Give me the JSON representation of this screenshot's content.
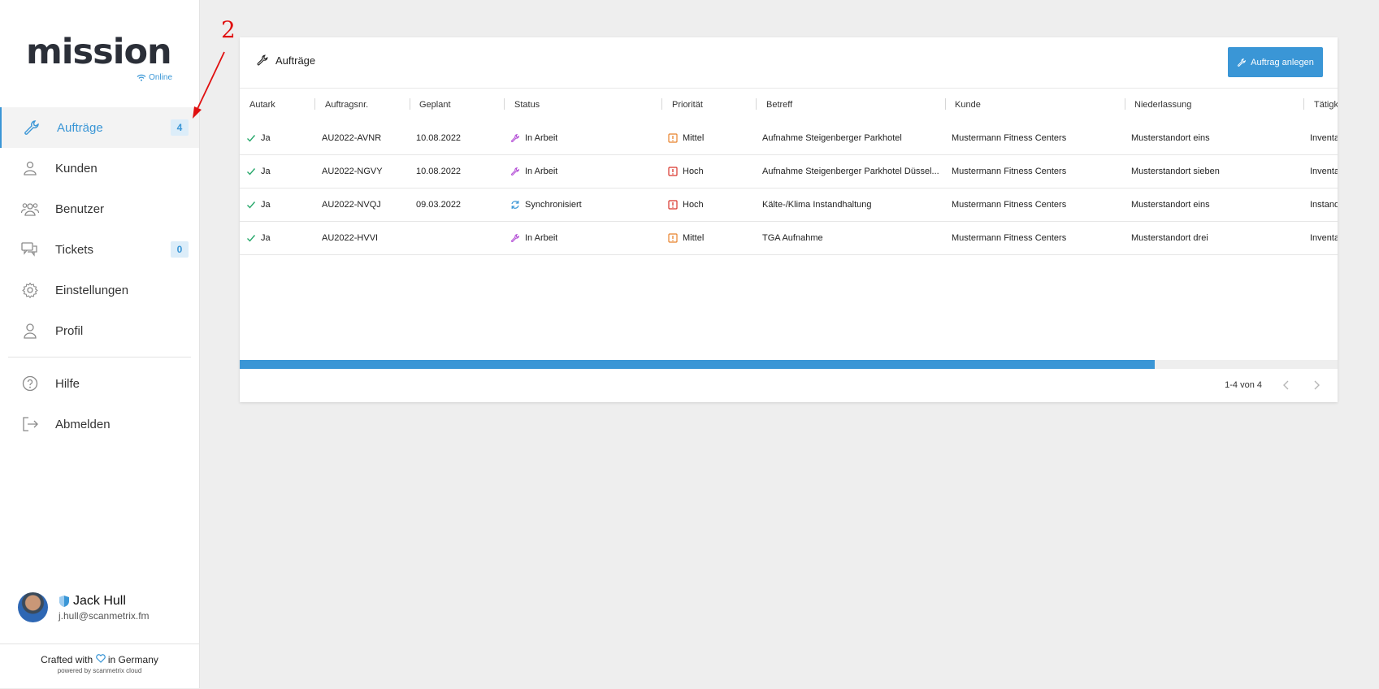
{
  "brand": {
    "logo": "mission",
    "status": "Online"
  },
  "nav": {
    "items": [
      {
        "label": "Aufträge",
        "badge": "4"
      },
      {
        "label": "Kunden"
      },
      {
        "label": "Benutzer"
      },
      {
        "label": "Tickets",
        "badge": "0"
      },
      {
        "label": "Einstellungen"
      },
      {
        "label": "Profil"
      },
      {
        "label": "Hilfe"
      },
      {
        "label": "Abmelden"
      }
    ]
  },
  "user": {
    "name": "Jack Hull",
    "email": "j.hull@scanmetrix.fm"
  },
  "footer": {
    "crafted_prefix": "Crafted with",
    "crafted_suffix": "in Germany",
    "powered": "powered by scanmetrix cloud"
  },
  "annotation": {
    "number": "2"
  },
  "card": {
    "title": "Aufträge",
    "add_button": "Auftrag anlegen"
  },
  "table": {
    "columns": [
      "Autark",
      "Auftragsnr.",
      "Geplant",
      "Status",
      "Priorität",
      "Betreff",
      "Kunde",
      "Niederlassung",
      "Tätigk"
    ],
    "rows": [
      {
        "autark": "Ja",
        "nr": "AU2022-AVNR",
        "geplant": "10.08.2022",
        "status": "In Arbeit",
        "status_icon": "wrench-icon",
        "prio": "Mittel",
        "prio_color": "#e8822c",
        "betreff": "Aufnahme Steigenberger Parkhotel",
        "kunde": "Mustermann Fitness Centers",
        "niederlassung": "Musterstandort eins",
        "taetigkeit": "Inventa"
      },
      {
        "autark": "Ja",
        "nr": "AU2022-NGVY",
        "geplant": "10.08.2022",
        "status": "In Arbeit",
        "status_icon": "wrench-icon",
        "prio": "Hoch",
        "prio_color": "#d9342b",
        "betreff": "Aufnahme Steigenberger Parkhotel Düssel...",
        "kunde": "Mustermann Fitness Centers",
        "niederlassung": "Musterstandort sieben",
        "taetigkeit": "Inventa"
      },
      {
        "autark": "Ja",
        "nr": "AU2022-NVQJ",
        "geplant": "09.03.2022",
        "status": "Synchronisiert",
        "status_icon": "sync-icon",
        "prio": "Hoch",
        "prio_color": "#d9342b",
        "betreff": "Kälte-/Klima Instandhaltung",
        "kunde": "Mustermann Fitness Centers",
        "niederlassung": "Musterstandort eins",
        "taetigkeit": "Instand"
      },
      {
        "autark": "Ja",
        "nr": "AU2022-HVVI",
        "geplant": "",
        "status": "In Arbeit",
        "status_icon": "wrench-icon",
        "prio": "Mittel",
        "prio_color": "#e8822c",
        "betreff": "TGA Aufnahme",
        "kunde": "Mustermann Fitness Centers",
        "niederlassung": "Musterstandort drei",
        "taetigkeit": "Inventa"
      }
    ]
  },
  "pagination": {
    "text": "1-4 von 4"
  },
  "colors": {
    "accent": "#3a96d6",
    "check": "#27a86b",
    "wrench": "#b44fd6"
  }
}
